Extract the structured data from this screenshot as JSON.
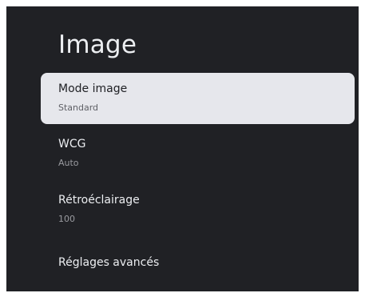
{
  "page": {
    "title": "Image"
  },
  "menu": [
    {
      "title": "Mode image",
      "value": "Standard",
      "focused": true
    },
    {
      "title": "WCG",
      "value": "Auto",
      "focused": false
    },
    {
      "title": "Rétroéclairage",
      "value": "100",
      "focused": false
    },
    {
      "title": "Réglages avancés",
      "value": null,
      "focused": false
    }
  ],
  "colors": {
    "panel_background": "#202125",
    "focused_item_background": "#e6e7ec",
    "text_primary": "#eceef1",
    "text_secondary": "#9a9ba0"
  }
}
